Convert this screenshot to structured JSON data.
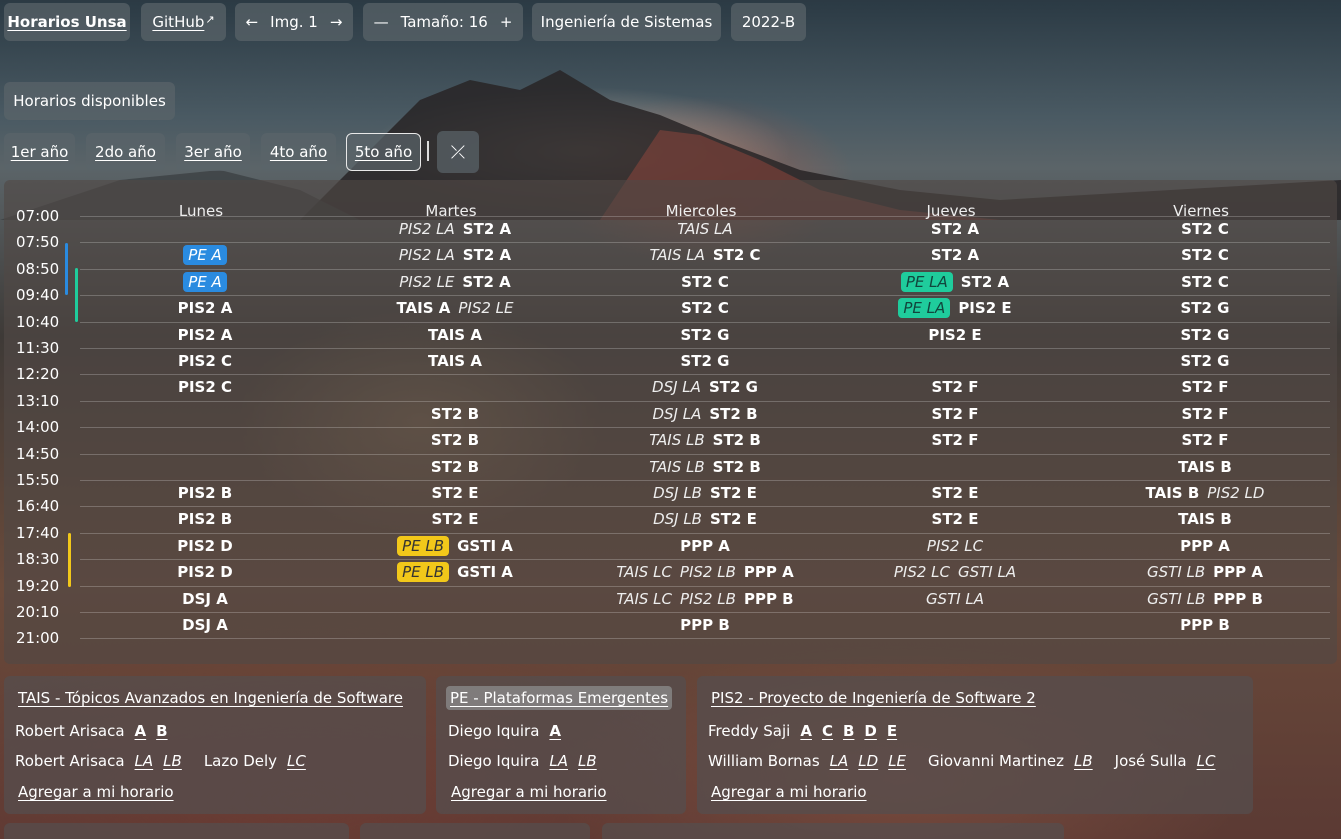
{
  "nav": {
    "brand": "Horarios Unsa",
    "github": "GitHub",
    "github_arrow": "↗",
    "img_prev": "←",
    "img_label": "Img. 1",
    "img_next": "→",
    "size_minus": "—",
    "size_label": "Tamaño: 16",
    "size_plus": "+",
    "career": "Ingeniería de Sistemas",
    "semester": "2022-B"
  },
  "available_label": "Horarios disponibles",
  "years": [
    "1er año",
    "2do año",
    "3er año",
    "4to año",
    "5to año"
  ],
  "compress_icon": "⤫",
  "days": [
    "Lunes",
    "Martes",
    "Miercoles",
    "Jueves",
    "Viernes"
  ],
  "times": [
    "07:00",
    "07:50",
    "08:50",
    "09:40",
    "10:40",
    "11:30",
    "12:20",
    "13:10",
    "14:00",
    "14:50",
    "15:50",
    "16:40",
    "17:40",
    "18:30",
    "19:20",
    "20:10",
    "21:00"
  ],
  "grid": [
    [
      [],
      [
        [
          "i",
          "PIS2 LA"
        ],
        [
          "b",
          "ST2 A"
        ]
      ],
      [
        [
          "i",
          "TAIS LA"
        ]
      ],
      [
        [
          "b",
          "ST2 A"
        ]
      ],
      [
        [
          "b",
          "ST2 C"
        ]
      ]
    ],
    [
      [
        [
          "blue",
          "PE A"
        ]
      ],
      [
        [
          "i",
          "PIS2 LA"
        ],
        [
          "b",
          "ST2 A"
        ]
      ],
      [
        [
          "i",
          "TAIS LA"
        ],
        [
          "b",
          "ST2 C"
        ]
      ],
      [
        [
          "b",
          "ST2 A"
        ]
      ],
      [
        [
          "b",
          "ST2 C"
        ]
      ]
    ],
    [
      [
        [
          "blue",
          "PE A"
        ]
      ],
      [
        [
          "i",
          "PIS2 LE"
        ],
        [
          "b",
          "ST2 A"
        ]
      ],
      [
        [
          "b",
          "ST2 C"
        ]
      ],
      [
        [
          "teal",
          "PE LA"
        ],
        [
          "b",
          "ST2 A"
        ]
      ],
      [
        [
          "b",
          "ST2 C"
        ]
      ]
    ],
    [
      [
        [
          "b",
          "PIS2 A"
        ]
      ],
      [
        [
          "b",
          "TAIS A"
        ],
        [
          "i",
          "PIS2 LE"
        ]
      ],
      [
        [
          "b",
          "ST2 C"
        ]
      ],
      [
        [
          "teal",
          "PE LA"
        ],
        [
          "b",
          "PIS2 E"
        ]
      ],
      [
        [
          "b",
          "ST2 G"
        ]
      ]
    ],
    [
      [
        [
          "b",
          "PIS2 A"
        ]
      ],
      [
        [
          "b",
          "TAIS A"
        ]
      ],
      [
        [
          "b",
          "ST2 G"
        ]
      ],
      [
        [
          "b",
          "PIS2 E"
        ]
      ],
      [
        [
          "b",
          "ST2 G"
        ]
      ]
    ],
    [
      [
        [
          "b",
          "PIS2 C"
        ]
      ],
      [
        [
          "b",
          "TAIS A"
        ]
      ],
      [
        [
          "b",
          "ST2 G"
        ]
      ],
      [],
      [
        [
          "b",
          "ST2 G"
        ]
      ]
    ],
    [
      [
        [
          "b",
          "PIS2 C"
        ]
      ],
      [],
      [
        [
          "i",
          "DSJ LA"
        ],
        [
          "b",
          "ST2 G"
        ]
      ],
      [
        [
          "b",
          "ST2 F"
        ]
      ],
      [
        [
          "b",
          "ST2 F"
        ]
      ]
    ],
    [
      [],
      [
        [
          "b",
          "ST2 B"
        ]
      ],
      [
        [
          "i",
          "DSJ LA"
        ],
        [
          "b",
          "ST2 B"
        ]
      ],
      [
        [
          "b",
          "ST2 F"
        ]
      ],
      [
        [
          "b",
          "ST2 F"
        ]
      ]
    ],
    [
      [],
      [
        [
          "b",
          "ST2 B"
        ]
      ],
      [
        [
          "i",
          "TAIS LB"
        ],
        [
          "b",
          "ST2 B"
        ]
      ],
      [
        [
          "b",
          "ST2 F"
        ]
      ],
      [
        [
          "b",
          "ST2 F"
        ]
      ]
    ],
    [
      [],
      [
        [
          "b",
          "ST2 B"
        ]
      ],
      [
        [
          "i",
          "TAIS LB"
        ],
        [
          "b",
          "ST2 B"
        ]
      ],
      [],
      [
        [
          "b",
          "TAIS B"
        ]
      ]
    ],
    [
      [
        [
          "b",
          "PIS2 B"
        ]
      ],
      [
        [
          "b",
          "ST2 E"
        ]
      ],
      [
        [
          "i",
          "DSJ LB"
        ],
        [
          "b",
          "ST2 E"
        ]
      ],
      [
        [
          "b",
          "ST2 E"
        ]
      ],
      [
        [
          "b",
          "TAIS B"
        ],
        [
          "i",
          "PIS2 LD"
        ]
      ]
    ],
    [
      [
        [
          "b",
          "PIS2 B"
        ]
      ],
      [
        [
          "b",
          "ST2 E"
        ]
      ],
      [
        [
          "i",
          "DSJ LB"
        ],
        [
          "b",
          "ST2 E"
        ]
      ],
      [
        [
          "b",
          "ST2 E"
        ]
      ],
      [
        [
          "b",
          "TAIS B"
        ]
      ]
    ],
    [
      [
        [
          "b",
          "PIS2 D"
        ]
      ],
      [
        [
          "yellow",
          "PE LB"
        ],
        [
          "b",
          "GSTI A"
        ]
      ],
      [
        [
          "b",
          "PPP A"
        ]
      ],
      [
        [
          "i",
          "PIS2 LC"
        ]
      ],
      [
        [
          "b",
          "PPP A"
        ]
      ]
    ],
    [
      [
        [
          "b",
          "PIS2 D"
        ]
      ],
      [
        [
          "yellow",
          "PE LB"
        ],
        [
          "b",
          "GSTI A"
        ]
      ],
      [
        [
          "i",
          "TAIS LC"
        ],
        [
          "i",
          "PIS2 LB"
        ],
        [
          "b",
          "PPP A"
        ]
      ],
      [
        [
          "i",
          "PIS2 LC"
        ],
        [
          "i",
          "GSTI LA"
        ]
      ],
      [
        [
          "i",
          "GSTI LB"
        ],
        [
          "b",
          "PPP A"
        ]
      ]
    ],
    [
      [
        [
          "b",
          "DSJ A"
        ]
      ],
      [],
      [
        [
          "i",
          "TAIS LC"
        ],
        [
          "i",
          "PIS2 LB"
        ],
        [
          "b",
          "PPP B"
        ]
      ],
      [
        [
          "i",
          "GSTI LA"
        ]
      ],
      [
        [
          "i",
          "GSTI LB"
        ],
        [
          "b",
          "PPP B"
        ]
      ]
    ],
    [
      [
        [
          "b",
          "DSJ A"
        ]
      ],
      [],
      [
        [
          "b",
          "PPP B"
        ]
      ],
      [],
      [
        [
          "b",
          "PPP B"
        ]
      ]
    ]
  ],
  "colors": {
    "blue": "#2a8be0",
    "teal": "#1fcc9c",
    "yellow": "#f2c81a"
  },
  "cards": [
    {
      "title": "TAIS - Tópicos Avanzados en Ingeniería de Software",
      "selected": false,
      "row1": [
        {
          "name": "Robert Arisaca",
          "secs": [
            "A",
            "B"
          ],
          "bold": true
        }
      ],
      "row2": [
        {
          "name": "Robert Arisaca",
          "secs": [
            "LA",
            "LB"
          ],
          "bold": false
        },
        {
          "name": "Lazo Dely",
          "secs": [
            "LC"
          ],
          "bold": false
        }
      ],
      "add": "Agregar a mi horario"
    },
    {
      "title": "PE - Plataformas Emergentes",
      "selected": true,
      "row1": [
        {
          "name": "Diego Iquira",
          "secs": [
            "A"
          ],
          "bold": true
        }
      ],
      "row2": [
        {
          "name": "Diego Iquira",
          "secs": [
            "LA",
            "LB"
          ],
          "bold": false
        }
      ],
      "add": "Agregar a mi horario"
    },
    {
      "title": "PIS2 - Proyecto de Ingeniería de Software 2",
      "selected": false,
      "row1": [
        {
          "name": "Freddy Saji",
          "secs": [
            "A",
            "C",
            "B",
            "D",
            "E"
          ],
          "bold": true
        }
      ],
      "row2": [
        {
          "name": "William Bornas",
          "secs": [
            "LA",
            "LD",
            "LE"
          ],
          "bold": false
        },
        {
          "name": "Giovanni Martinez",
          "secs": [
            "LB"
          ],
          "bold": false
        },
        {
          "name": "José Sulla",
          "secs": [
            "LC"
          ],
          "bold": false
        }
      ],
      "add": "Agregar a mi horario"
    }
  ]
}
